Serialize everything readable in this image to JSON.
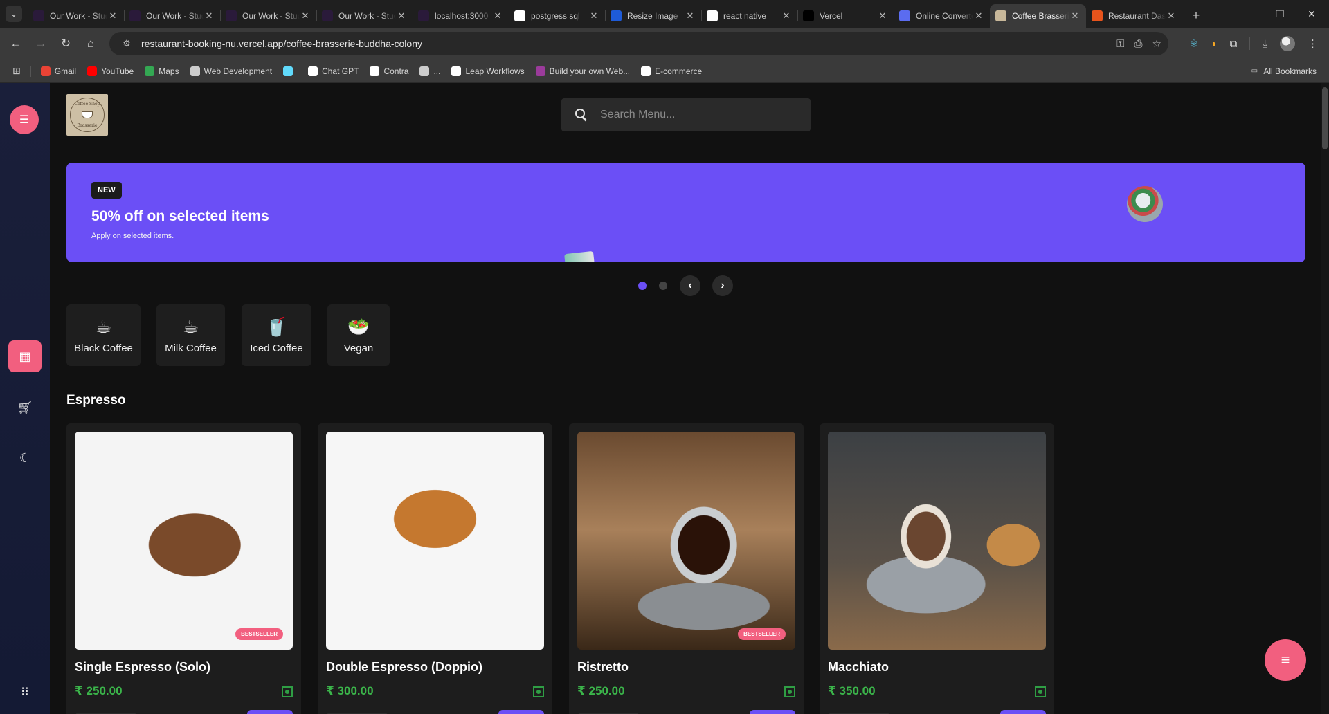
{
  "browser": {
    "tabs": [
      {
        "title": "Our Work - Studio",
        "favicon": "studio-logo",
        "color": "#2a1a3a",
        "active": false
      },
      {
        "title": "Our Work - Studio",
        "favicon": "studio-logo",
        "color": "#2a1a3a",
        "active": false
      },
      {
        "title": "Our Work - Studio",
        "favicon": "studio-logo",
        "color": "#2a1a3a",
        "active": false
      },
      {
        "title": "Our Work - Studio",
        "favicon": "studio-logo",
        "color": "#2a1a3a",
        "active": false
      },
      {
        "title": "localhost:3000",
        "favicon": "studio-logo",
        "color": "#2a1a3a",
        "active": false
      },
      {
        "title": "postgress sql",
        "favicon": "google-logo",
        "color": "#ffffff",
        "active": false
      },
      {
        "title": "Resize Image",
        "favicon": "resize-logo",
        "color": "#1e5bd8",
        "active": false
      },
      {
        "title": "react native",
        "favicon": "google-logo",
        "color": "#ffffff",
        "active": false
      },
      {
        "title": "Vercel",
        "favicon": "vercel-logo",
        "color": "#000000",
        "active": false
      },
      {
        "title": "Online Converter",
        "favicon": "converter-logo",
        "color": "#5b6cf0",
        "active": false
      },
      {
        "title": "Coffee Brasserie",
        "favicon": "coffee-logo",
        "color": "#c8b89a",
        "active": true
      },
      {
        "title": "Restaurant Dashboard",
        "favicon": "fire-logo",
        "color": "#e8541c",
        "active": false
      }
    ],
    "url": "restaurant-booking-nu.vercel.app/coffee-brasserie-buddha-colony",
    "bookmarks": [
      {
        "label": "Gmail",
        "icon": "gmail-icon",
        "color": "#ea4335"
      },
      {
        "label": "YouTube",
        "icon": "youtube-icon",
        "color": "#ff0000"
      },
      {
        "label": "Maps",
        "icon": "maps-icon",
        "color": "#34a853"
      },
      {
        "label": "Web Development",
        "icon": "folder-icon",
        "color": "#cccccc"
      },
      {
        "label": "",
        "icon": "react-icon",
        "color": "#61dafb"
      },
      {
        "label": "Chat GPT",
        "icon": "chatgpt-icon",
        "color": "#ffffff"
      },
      {
        "label": "Contra",
        "icon": "contra-icon",
        "color": "#ffffff"
      },
      {
        "label": "...",
        "icon": "globe-icon",
        "color": "#cccccc"
      },
      {
        "label": "Leap Workflows",
        "icon": "leap-icon",
        "color": "#ffffff"
      },
      {
        "label": "Build your own Web...",
        "icon": "studio-icon",
        "color": "#9b3b9b"
      },
      {
        "label": "E-commerce",
        "icon": "chatgpt-icon",
        "color": "#ffffff"
      }
    ],
    "all_bookmarks": "All Bookmarks"
  },
  "search": {
    "placeholder": "Search Menu..."
  },
  "banner": {
    "badge": "NEW",
    "title": "50% off on selected items",
    "subtitle": "Apply on selected items."
  },
  "categories": [
    {
      "label": "Black Coffee",
      "icon": "black-coffee-icon",
      "glyph": "☕"
    },
    {
      "label": "Milk Coffee",
      "icon": "milk-coffee-icon",
      "glyph": "☕"
    },
    {
      "label": "Iced Coffee",
      "icon": "iced-coffee-icon",
      "glyph": "🥤"
    },
    {
      "label": "Vegan",
      "icon": "vegan-icon",
      "glyph": "🥗"
    }
  ],
  "section": {
    "title": "Espresso"
  },
  "products": [
    {
      "name": "Single Espresso (Solo)",
      "price": "₹ 250.00",
      "badge": "BESTSELLER"
    },
    {
      "name": "Double Espresso (Doppio)",
      "price": "₹ 300.00",
      "badge": ""
    },
    {
      "name": "Ristretto",
      "price": "₹ 250.00",
      "badge": "BESTSELLER"
    },
    {
      "name": "Macchiato",
      "price": "₹ 350.00",
      "badge": ""
    }
  ],
  "colors": {
    "accent_purple": "#6b4ff6",
    "accent_pink": "#f25f7f",
    "price_green": "#3bb54a",
    "sidebar_navy": "#1a1f3a",
    "page_bg": "#111111"
  }
}
